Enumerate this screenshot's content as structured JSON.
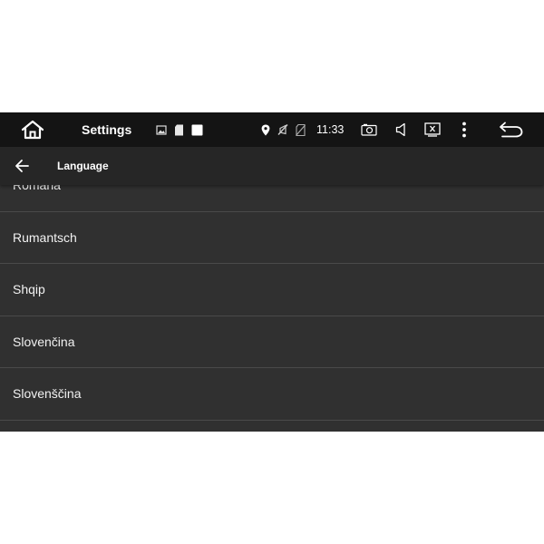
{
  "status_bar": {
    "app_title": "Settings",
    "time": "11:33",
    "icons": {
      "home": "home-icon",
      "notifications": [
        "image-icon",
        "sd-card-icon",
        "square-icon"
      ],
      "status": [
        "location-icon",
        "mute-icon",
        "no-sim-icon"
      ],
      "controls": [
        "screenshot-icon",
        "volume-icon",
        "close-app-icon",
        "overflow-menu-icon",
        "back-icon"
      ]
    }
  },
  "action_bar": {
    "back_icon": "arrow-left-icon",
    "title": "Language"
  },
  "languages": [
    "Română",
    "Rumantsch",
    "Shqip",
    "Slovenčina",
    "Slovenščina"
  ],
  "colors": {
    "status_bar_bg": "#141414",
    "action_bar_bg": "#262626",
    "list_bg": "#303030",
    "divider": "#4a4a4a",
    "text": "#ffffff"
  }
}
